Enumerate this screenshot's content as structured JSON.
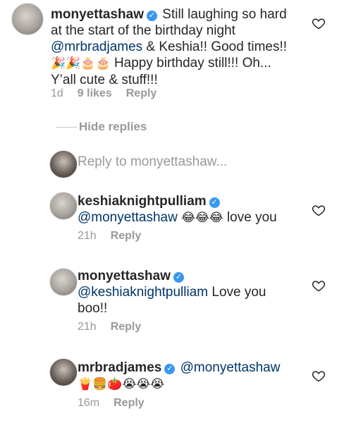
{
  "comment": {
    "username": "monyettashaw",
    "text_1": "Still laughing so hard",
    "text_2a": "at the start of the birthday night",
    "mention_1": "@mrbradjames",
    "text_2b": " & Keshia!! Good times!!",
    "emojis_1": "🎉🎉🎂🎂",
    "text_3": " Happy birthday still!!! Oh...",
    "text_4": "Y’all cute & stuff!!!",
    "time": "1d",
    "likes": "9 likes",
    "reply_label": "Reply"
  },
  "hide_replies": "Hide replies",
  "reply_input": {
    "placeholder": "Reply to monyettashaw..."
  },
  "replies": [
    {
      "username": "keshiaknightpulliam",
      "mention": "@monyettashaw",
      "emojis": "😂😂😂",
      "text": " love you",
      "time": "21h",
      "reply_label": "Reply"
    },
    {
      "username": "monyettashaw",
      "mention": "@keshiaknightpulliam",
      "text": " Love you",
      "text_2": "boo!!",
      "time": "21h",
      "reply_label": "Reply"
    },
    {
      "username": "mrbradjames",
      "mention": "@monyettashaw",
      "emojis": "🍟🍔🍅😭😭😭",
      "time": "16m",
      "reply_label": "Reply"
    }
  ],
  "colors": {
    "mention": "#003569",
    "verified": "#3897f0",
    "meta": "#999999"
  },
  "icons": {
    "like": "heart-outline-icon",
    "verified": "verified-badge-icon"
  }
}
